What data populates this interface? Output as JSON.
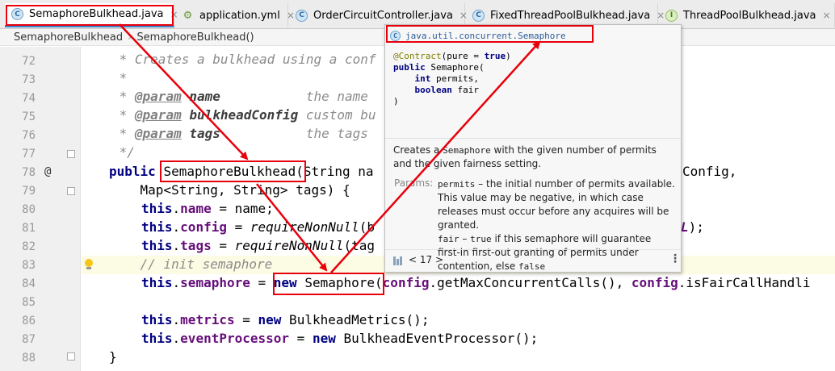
{
  "tabs": [
    {
      "label": "SemaphoreBulkhead.java",
      "icon": "class-icon",
      "glyph": "C",
      "close": "×"
    },
    {
      "label": "application.yml",
      "icon": "yaml-icon",
      "glyph": "⚙",
      "close": "×"
    },
    {
      "label": "OrderCircuitController.java",
      "icon": "class-icon",
      "glyph": "C",
      "close": "×"
    },
    {
      "label": "FixedThreadPoolBulkhead.java",
      "icon": "class-icon",
      "glyph": "C",
      "close": "×"
    },
    {
      "label": "ThreadPoolBulkhead.java",
      "icon": "interface-icon",
      "glyph": "I",
      "close": "×"
    }
  ],
  "breadcrumb": {
    "class_name": "SemaphoreBulkhead",
    "separator": "›",
    "method": "SemaphoreBulkhead()"
  },
  "gutter": {
    "line_numbers": [
      "72",
      "73",
      "74",
      "75",
      "76",
      "77",
      "78",
      "79",
      "80",
      "81",
      "82",
      "83",
      "84",
      "85",
      "86",
      "87",
      "88"
    ],
    "override_marker": "@"
  },
  "code": {
    "l72": {
      "text": " * Creates a bulkhead using a conf"
    },
    "l73": {
      "text": " *"
    },
    "l74": {
      "star": " * ",
      "tag": "@param",
      "pname": "name",
      "desc": "           the name"
    },
    "l75": {
      "star": " * ",
      "tag": "@param",
      "pname": "bulkheadConfig",
      "desc": " custom bu"
    },
    "l76": {
      "star": " * ",
      "tag": "@param",
      "pname": "tags",
      "desc": "           the tags"
    },
    "l77": {
      "text": " */"
    },
    "l78": {
      "kw": "public",
      "name": "SemaphoreBulkhead",
      "rest": "(String na",
      "tail": "Config,"
    },
    "l79": {
      "text": "    Map<String, String> tags) {"
    },
    "l80": {
      "this": "this",
      "field": "name",
      "rest": " = name;"
    },
    "l81": {
      "this": "this",
      "field": "config",
      "mid": " = ",
      "method": "requireNonNull",
      "rest": "(b",
      "tail": "L",
      "tail2": ");"
    },
    "l82": {
      "this": "this",
      "field": "tags",
      "mid": " = ",
      "method": "requireNonNull",
      "rest": "(tag"
    },
    "l83": {
      "text": "    // init semaphore"
    },
    "l84": {
      "this": "this",
      "field": "semaphore",
      "mid": " = ",
      "kw": "new",
      "cls": "Semaphore",
      "rest1": "(",
      "f1": "config",
      "rest2": ".getMaxConcurrentCalls(), ",
      "f2": "config",
      "rest3": ".isFairCallHandli"
    },
    "l86": {
      "this": "this",
      "field": "metrics",
      "mid": " = ",
      "kw": "new",
      "rest": " BulkheadMetrics();"
    },
    "l87": {
      "this": "this",
      "field": "eventProcessor",
      "mid": " = ",
      "kw": "new",
      "rest": " BulkheadEventProcessor();"
    },
    "l88": {
      "text": "}"
    }
  },
  "popup": {
    "header": "java.util.concurrent.Semaphore",
    "sig_annotation": "@Contract",
    "sig_annotation_args": "(pure = ",
    "sig_true": "true",
    "sig_close": ")",
    "sig_public": "public",
    "sig_ctor": " Semaphore(",
    "sig_int": "int",
    "sig_permits": " permits,",
    "sig_boolean": "boolean",
    "sig_fair": " fair",
    "sig_end": ")",
    "desc_1": "Creates a ",
    "desc_code": "Semaphore",
    "desc_2": " with the given number of permits and the given fairness setting.",
    "params_label": "Params:",
    "p1_name": "permits",
    "p1_desc": " – the initial number of permits available. This value may be negative, in which case releases must occur before any acquires will be granted.",
    "p2_name": "fair",
    "p2_desc_1": " – ",
    "p2_true": "true",
    "p2_desc_2": " if this semaphore will guarantee first-in first-out granting of permits under contention, else ",
    "p2_false": "false",
    "jdk": "< 17 >",
    "more": "⋮"
  },
  "colors": {
    "annotation_red": "#e8000b",
    "keyword": "#000080",
    "field": "#660e7a",
    "comment": "#8c8c8c"
  }
}
